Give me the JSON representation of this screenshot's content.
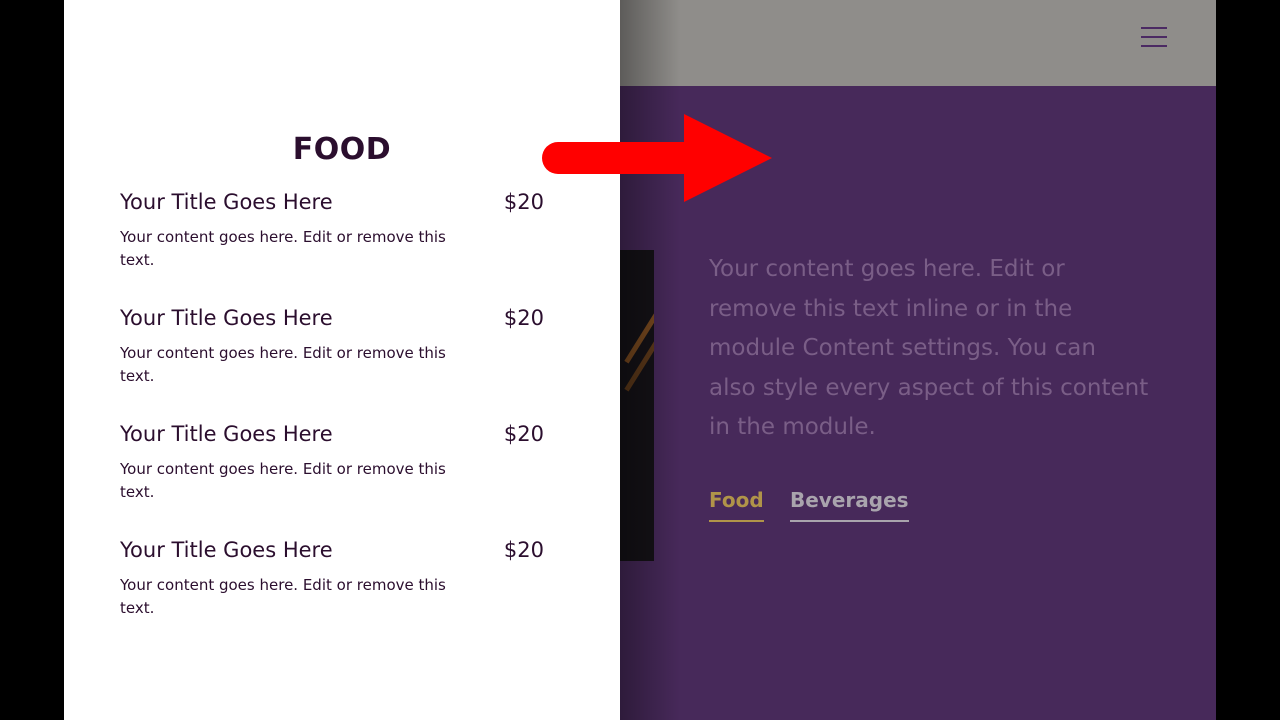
{
  "menu_panel": {
    "heading": "FOOD",
    "items": [
      {
        "title": "Your Title Goes Here",
        "price": "$20",
        "description": "Your content goes here. Edit or remove this text."
      },
      {
        "title": "Your Title Goes Here",
        "price": "$20",
        "description": "Your content goes here. Edit or remove this text."
      },
      {
        "title": "Your Title Goes Here",
        "price": "$20",
        "description": "Your content goes here. Edit or remove this text."
      },
      {
        "title": "Your Title Goes Here",
        "price": "$20",
        "description": "Your content goes here. Edit or remove this text."
      }
    ]
  },
  "background_page": {
    "body_text": "Your content goes here. Edit or remove this text inline or in the module Content settings. You can also style every aspect of this content in the module.",
    "tabs": [
      {
        "label": "Food",
        "active": true
      },
      {
        "label": "Beverages",
        "active": false
      }
    ],
    "menu_icon": "hamburger-menu-icon"
  },
  "annotation": {
    "icon": "arrow-right-icon",
    "color": "#ff0000"
  },
  "colors": {
    "panel_text": "#2b0e2e",
    "page_purple": "#47295a",
    "header_gray": "#8f8d8a",
    "tab_active": "#b09449",
    "tab_inactive": "#a9a4ad"
  }
}
